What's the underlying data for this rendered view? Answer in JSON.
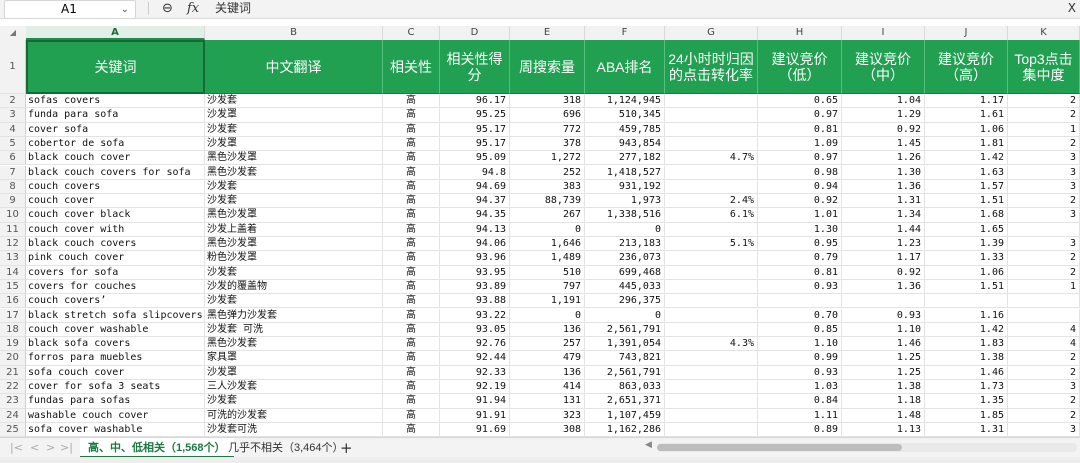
{
  "formula_bar": {
    "name_box": "A1",
    "zoom_icon": "search-zoom-icon",
    "fx_label": "fx",
    "content": "关键词",
    "right_glyph": "X"
  },
  "columns": [
    "A",
    "B",
    "C",
    "D",
    "E",
    "F",
    "G",
    "H",
    "I",
    "J",
    "K"
  ],
  "selected_cell": "A1",
  "header_row_number": "1",
  "headers": [
    "关键词",
    "中文翻译",
    "相关性",
    "相关性得分",
    "周搜索量",
    "ABA排名",
    "24小时时归因的点击转化率",
    "建议竞价（低）",
    "建议竞价（中）",
    "建议竞价（高）",
    "Top3点击集中度"
  ],
  "rows": [
    {
      "n": "2",
      "cells": [
        "sofas covers",
        "沙发套",
        "高",
        "96.17",
        "318",
        "1,124,945",
        "",
        "0.65",
        "1.04",
        "1.17",
        "2"
      ]
    },
    {
      "n": "3",
      "cells": [
        "funda para sofa",
        "沙发罩",
        "高",
        "95.25",
        "696",
        "510,345",
        "",
        "0.97",
        "1.29",
        "1.61",
        "2"
      ]
    },
    {
      "n": "4",
      "cells": [
        "cover sofa",
        "沙发套",
        "高",
        "95.17",
        "772",
        "459,785",
        "",
        "0.81",
        "0.92",
        "1.06",
        "1"
      ]
    },
    {
      "n": "5",
      "cells": [
        "cobertor de sofa",
        "沙发罩",
        "高",
        "95.17",
        "378",
        "943,854",
        "",
        "1.09",
        "1.45",
        "1.81",
        "2"
      ]
    },
    {
      "n": "6",
      "cells": [
        "black couch cover",
        "黑色沙发罩",
        "高",
        "95.09",
        "1,272",
        "277,182",
        "4.7%",
        "0.97",
        "1.26",
        "1.42",
        "3"
      ]
    },
    {
      "n": "7",
      "cells": [
        "black couch covers for sofa",
        "黑色沙发套",
        "高",
        "94.8",
        "252",
        "1,418,527",
        "",
        "0.98",
        "1.30",
        "1.63",
        "3"
      ]
    },
    {
      "n": "8",
      "cells": [
        "couch covers",
        "沙发套",
        "高",
        "94.69",
        "383",
        "931,192",
        "",
        "0.94",
        "1.36",
        "1.57",
        "3"
      ]
    },
    {
      "n": "9",
      "cells": [
        "couch cover",
        "沙发套",
        "高",
        "94.37",
        "88,739",
        "1,973",
        "2.4%",
        "0.92",
        "1.31",
        "1.51",
        "2"
      ]
    },
    {
      "n": "10",
      "cells": [
        "couch cover black",
        "黑色沙发罩",
        "高",
        "94.35",
        "267",
        "1,338,516",
        "6.1%",
        "1.01",
        "1.34",
        "1.68",
        "3"
      ]
    },
    {
      "n": "11",
      "cells": [
        "couch cover with",
        "沙发上盖着",
        "高",
        "94.13",
        "0",
        "0",
        "",
        "1.30",
        "1.44",
        "1.65",
        ""
      ]
    },
    {
      "n": "12",
      "cells": [
        "black couch covers",
        "黑色沙发罩",
        "高",
        "94.06",
        "1,646",
        "213,183",
        "5.1%",
        "0.95",
        "1.23",
        "1.39",
        "3"
      ]
    },
    {
      "n": "13",
      "cells": [
        "pink couch cover",
        "粉色沙发罩",
        "高",
        "93.96",
        "1,489",
        "236,073",
        "",
        "0.79",
        "1.17",
        "1.33",
        "2"
      ]
    },
    {
      "n": "14",
      "cells": [
        "covers for sofa",
        "沙发套",
        "高",
        "93.95",
        "510",
        "699,468",
        "",
        "0.81",
        "0.92",
        "1.06",
        "2"
      ]
    },
    {
      "n": "15",
      "cells": [
        "covers for couches",
        "沙发的覆盖物",
        "高",
        "93.89",
        "797",
        "445,033",
        "",
        "0.93",
        "1.36",
        "1.51",
        "1"
      ]
    },
    {
      "n": "16",
      "cells": [
        "couch covers’",
        "沙发套",
        "高",
        "93.88",
        "1,191",
        "296,375",
        "",
        "",
        "",
        "",
        ""
      ]
    },
    {
      "n": "17",
      "cells": [
        "black stretch sofa slipcovers",
        "黑色弹力沙发套",
        "高",
        "93.22",
        "0",
        "0",
        "",
        "0.70",
        "0.93",
        "1.16",
        ""
      ]
    },
    {
      "n": "18",
      "cells": [
        "couch cover washable",
        "沙发套 可洗",
        "高",
        "93.05",
        "136",
        "2,561,791",
        "",
        "0.85",
        "1.10",
        "1.42",
        "4"
      ]
    },
    {
      "n": "19",
      "cells": [
        "black sofa covers",
        "黑色沙发套",
        "高",
        "92.76",
        "257",
        "1,391,054",
        "4.3%",
        "1.10",
        "1.46",
        "1.83",
        "4"
      ]
    },
    {
      "n": "20",
      "cells": [
        "forros para muebles",
        "家具罩",
        "高",
        "92.44",
        "479",
        "743,821",
        "",
        "0.99",
        "1.25",
        "1.38",
        "2"
      ]
    },
    {
      "n": "21",
      "cells": [
        "sofa couch cover",
        "沙发罩",
        "高",
        "92.33",
        "136",
        "2,561,791",
        "",
        "0.93",
        "1.25",
        "1.46",
        "2"
      ]
    },
    {
      "n": "22",
      "cells": [
        "cover for sofa 3 seats",
        "三人沙发套",
        "高",
        "92.19",
        "414",
        "863,033",
        "",
        "1.03",
        "1.38",
        "1.73",
        "3"
      ]
    },
    {
      "n": "23",
      "cells": [
        "fundas para sofas",
        "沙发套",
        "高",
        "91.94",
        "131",
        "2,651,371",
        "",
        "0.84",
        "1.18",
        "1.35",
        "2"
      ]
    },
    {
      "n": "24",
      "cells": [
        "washable couch cover",
        "可洗的沙发套",
        "高",
        "91.91",
        "323",
        "1,107,459",
        "",
        "1.11",
        "1.48",
        "1.85",
        "2"
      ]
    },
    {
      "n": "25",
      "cells": [
        "sofa cover washable",
        "沙发套可洗",
        "高",
        "91.69",
        "308",
        "1,162,286",
        "",
        "0.89",
        "1.13",
        "1.31",
        "3"
      ]
    }
  ],
  "tabs": [
    {
      "label": "高、中、低相关（1,568个）",
      "active": true
    },
    {
      "label": "几乎不相关（3,464个）",
      "active": false
    }
  ],
  "add_sheet_label": "+",
  "nav_glyphs": [
    "|<",
    "<",
    ">",
    ">|"
  ],
  "colors": {
    "header_green": "#22a052",
    "active_tab": "#1d7a45"
  }
}
